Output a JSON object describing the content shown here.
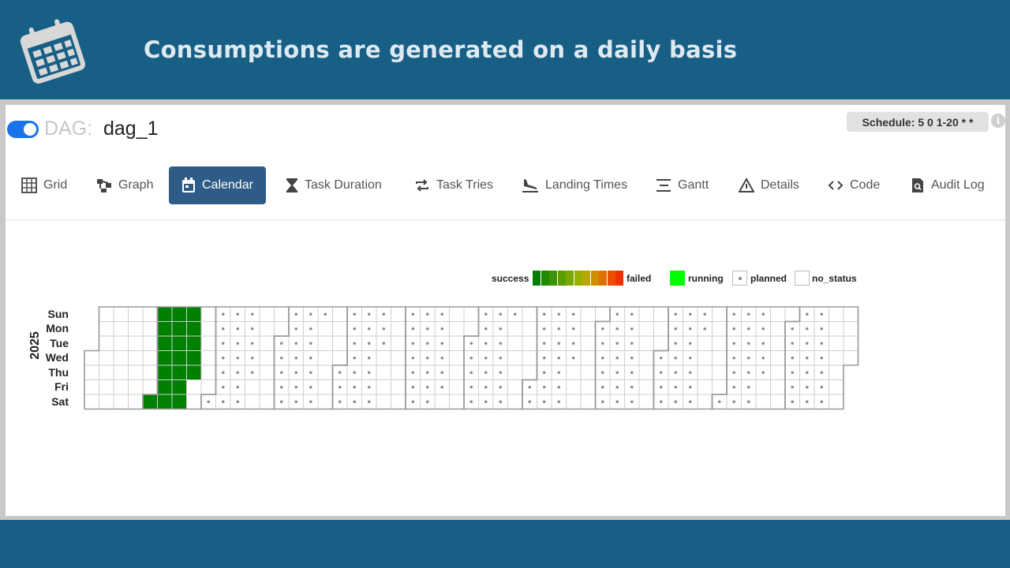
{
  "banner": {
    "title": "Consumptions are generated on a daily basis",
    "icon": "calendar-icon"
  },
  "header": {
    "dag_prefix": "DAG:",
    "dag_name": "dag_1",
    "toggle_state": "on",
    "schedule": "Schedule: 5 0 1-20 * *"
  },
  "tabs": [
    {
      "label": "Grid",
      "icon": "grid-icon",
      "active": false
    },
    {
      "label": "Graph",
      "icon": "graph-icon",
      "active": false
    },
    {
      "label": "Calendar",
      "icon": "calendar-icon",
      "active": true
    },
    {
      "label": "Task Duration",
      "icon": "hourglass-icon",
      "active": false
    },
    {
      "label": "Task Tries",
      "icon": "retry-icon",
      "active": false
    },
    {
      "label": "Landing Times",
      "icon": "plane-landing-icon",
      "active": false
    },
    {
      "label": "Gantt",
      "icon": "gantt-icon",
      "active": false
    },
    {
      "label": "Details",
      "icon": "warning-triangle-icon",
      "active": false
    },
    {
      "label": "Code",
      "icon": "code-icon",
      "active": false
    },
    {
      "label": "Audit Log",
      "icon": "audit-log-icon",
      "active": false
    }
  ],
  "legend": {
    "success": "success",
    "failed": "failed",
    "running": "running",
    "planned": "planned",
    "no_status": "no_status",
    "gradient_colors": [
      "#008000",
      "#1f8a00",
      "#3c9400",
      "#5a9e00",
      "#78a800",
      "#98b000",
      "#b8a800",
      "#d09000",
      "#e07000",
      "#ea5000",
      "#f03000"
    ],
    "running_color": "#00ff00"
  },
  "calendar": {
    "year": "2025",
    "days": [
      "Sun",
      "Mon",
      "Tue",
      "Wed",
      "Thu",
      "Fri",
      "Sat"
    ],
    "success_color": "#008000",
    "first_day_of_year_weekday": 3,
    "success_days": [
      "2025-02-01",
      "2025-02-02",
      "2025-02-03",
      "2025-02-04",
      "2025-02-05",
      "2025-02-06",
      "2025-02-07",
      "2025-02-08",
      "2025-02-09",
      "2025-02-10",
      "2025-02-11",
      "2025-02-12",
      "2025-02-13",
      "2025-02-14",
      "2025-02-15",
      "2025-02-16",
      "2025-02-17",
      "2025-02-18",
      "2025-02-19",
      "2025-02-20"
    ],
    "planned_rule": "days 1-20 of each month, Mar-Dec"
  }
}
